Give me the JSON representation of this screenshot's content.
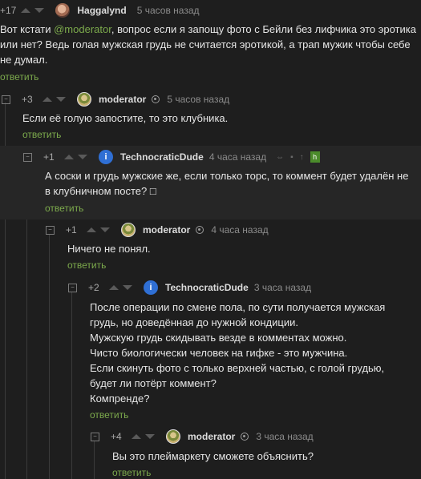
{
  "comments": [
    {
      "score": "+17",
      "author": "Haggalynd",
      "time": "5 часов назад",
      "avatar": "haggalynd-avatar",
      "text_before": "Вот кстати ",
      "mention": "@moderator",
      "text_after": ", вопрос если я запощу фото с Бейли без лифчика это эротика или нет? Ведь голая мужская грудь не считается эротикой, а трап мужик чтобы себе не думал.",
      "reply": "ответить"
    },
    {
      "score": "+3",
      "author": "moderator",
      "time": "5 часов назад",
      "avatar": "moderator-avatar",
      "lines": [
        "Если её голую запостите, то это клубника."
      ],
      "reply": "ответить"
    },
    {
      "score": "+1",
      "author": "TechnocraticDude",
      "time": "4 часа назад",
      "avatar": "technocraticdude-avatar",
      "avatar_letter": "i",
      "lines": [
        "А соски и грудь мужские же, если только торс, то коммент будет удалён не",
        "в клубничном посте? □"
      ],
      "reply": "ответить",
      "tool_green_label": "h"
    },
    {
      "score": "+1",
      "author": "moderator",
      "time": "4 часа назад",
      "avatar": "moderator-avatar",
      "lines": [
        "Ничего не понял."
      ],
      "reply": "ответить"
    },
    {
      "score": "+2",
      "author": "TechnocraticDude",
      "time": "3 часа назад",
      "avatar": "technocraticdude-avatar",
      "avatar_letter": "i",
      "lines": [
        "После операции по смене пола, по сути получается мужская",
        "грудь, но доведённая до нужной кондиции.",
        "Мужскую грудь скидывать везде в комментах можно.",
        "Чисто биологически человек на гифке - это мужчина.",
        "Если скинуть фото с только верхней частью, с голой грудью,",
        "будет ли потёрт коммент?",
        "Компренде?"
      ],
      "reply": "ответить"
    },
    {
      "score": "+4",
      "author": "moderator",
      "time": "3 часа назад",
      "avatar": "moderator-avatar",
      "lines": [
        "Вы это плеймаркету сможете объяснить?"
      ],
      "reply": "ответить"
    }
  ],
  "colors": {
    "accent": "#7caa4c",
    "background": "#1e1e1e",
    "highlight": "#262626"
  }
}
